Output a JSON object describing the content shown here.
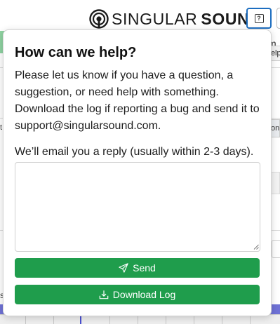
{
  "header": {
    "logo_word1": "SINGULAR",
    "logo_word2": "SOUND",
    "help_icon": "question-square-icon",
    "help_tooltip": "Help"
  },
  "background": {
    "fragment_m": "m",
    "fragment_ons": "ons",
    "fragment_t": "t",
    "fragment_s": "s"
  },
  "help_popover": {
    "title": "How can we help?",
    "body_paragraph_1": "Please let us know if you have a question, a suggestion, or need help with something. Download the log if reporting a bug and send it to support@singularsound.com.",
    "body_paragraph_2": "We’ll email you a reply (usually within 2-3 days).",
    "message_value": "",
    "send_label": "Send",
    "send_icon": "paper-plane-icon",
    "download_label": "Download Log",
    "download_icon": "download-icon"
  },
  "colors": {
    "accent_button": "#1f9d4c",
    "help_button_border": "#1d6ec0",
    "timeline_bar": "#6f72d6"
  }
}
